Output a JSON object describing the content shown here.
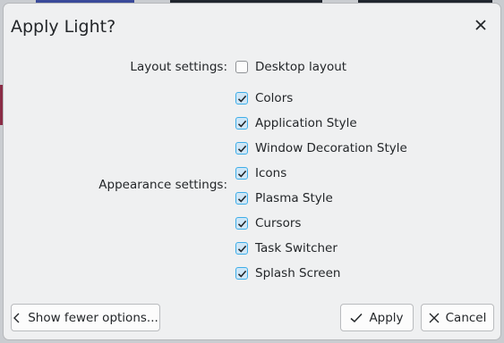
{
  "dialog": {
    "title": "Apply Light?",
    "close_icon": "close-icon"
  },
  "layout_settings": {
    "label": "Layout settings:",
    "options": [
      {
        "label": "Desktop layout",
        "checked": false
      }
    ]
  },
  "appearance_settings": {
    "label": "Appearance settings:",
    "options": [
      {
        "label": "Colors",
        "checked": true
      },
      {
        "label": "Application Style",
        "checked": true
      },
      {
        "label": "Window Decoration Style",
        "checked": true
      },
      {
        "label": "Icons",
        "checked": true
      },
      {
        "label": "Plasma Style",
        "checked": true
      },
      {
        "label": "Cursors",
        "checked": true
      },
      {
        "label": "Task Switcher",
        "checked": true
      },
      {
        "label": "Splash Screen",
        "checked": true
      }
    ]
  },
  "footer": {
    "show_fewer_label": "Show fewer options...",
    "apply_label": "Apply",
    "cancel_label": "Cancel"
  },
  "colors": {
    "accent": "#3daee9",
    "checkbox_fill": "#cfe6f6",
    "dialog_bg": "#eff0f1"
  }
}
